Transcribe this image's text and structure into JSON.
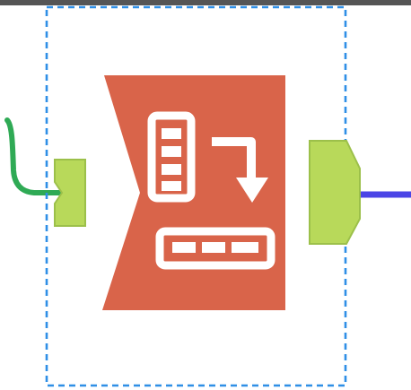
{
  "canvas": {
    "background": "#ffffff"
  },
  "colors": {
    "top_rule": "#555555",
    "selection_border": "#2f8fe6",
    "tool_body": "#d9644a",
    "tool_icon": "#ffffff",
    "anchor_fill": "#b8d95a",
    "anchor_stroke": "#9cc04a",
    "input_connector": "#2faa55",
    "output_connector": "#4b45e6"
  },
  "tool": {
    "name": "transpose-tool",
    "icon": "transpose-rows-to-columns-icon",
    "selected": true
  },
  "anchors": {
    "input": {
      "icon": "input-anchor"
    },
    "output": {
      "icon": "output-anchor"
    }
  },
  "connections": {
    "incoming": {
      "icon": "incoming-connection-line"
    },
    "outgoing": {
      "icon": "outgoing-connection-line"
    }
  }
}
